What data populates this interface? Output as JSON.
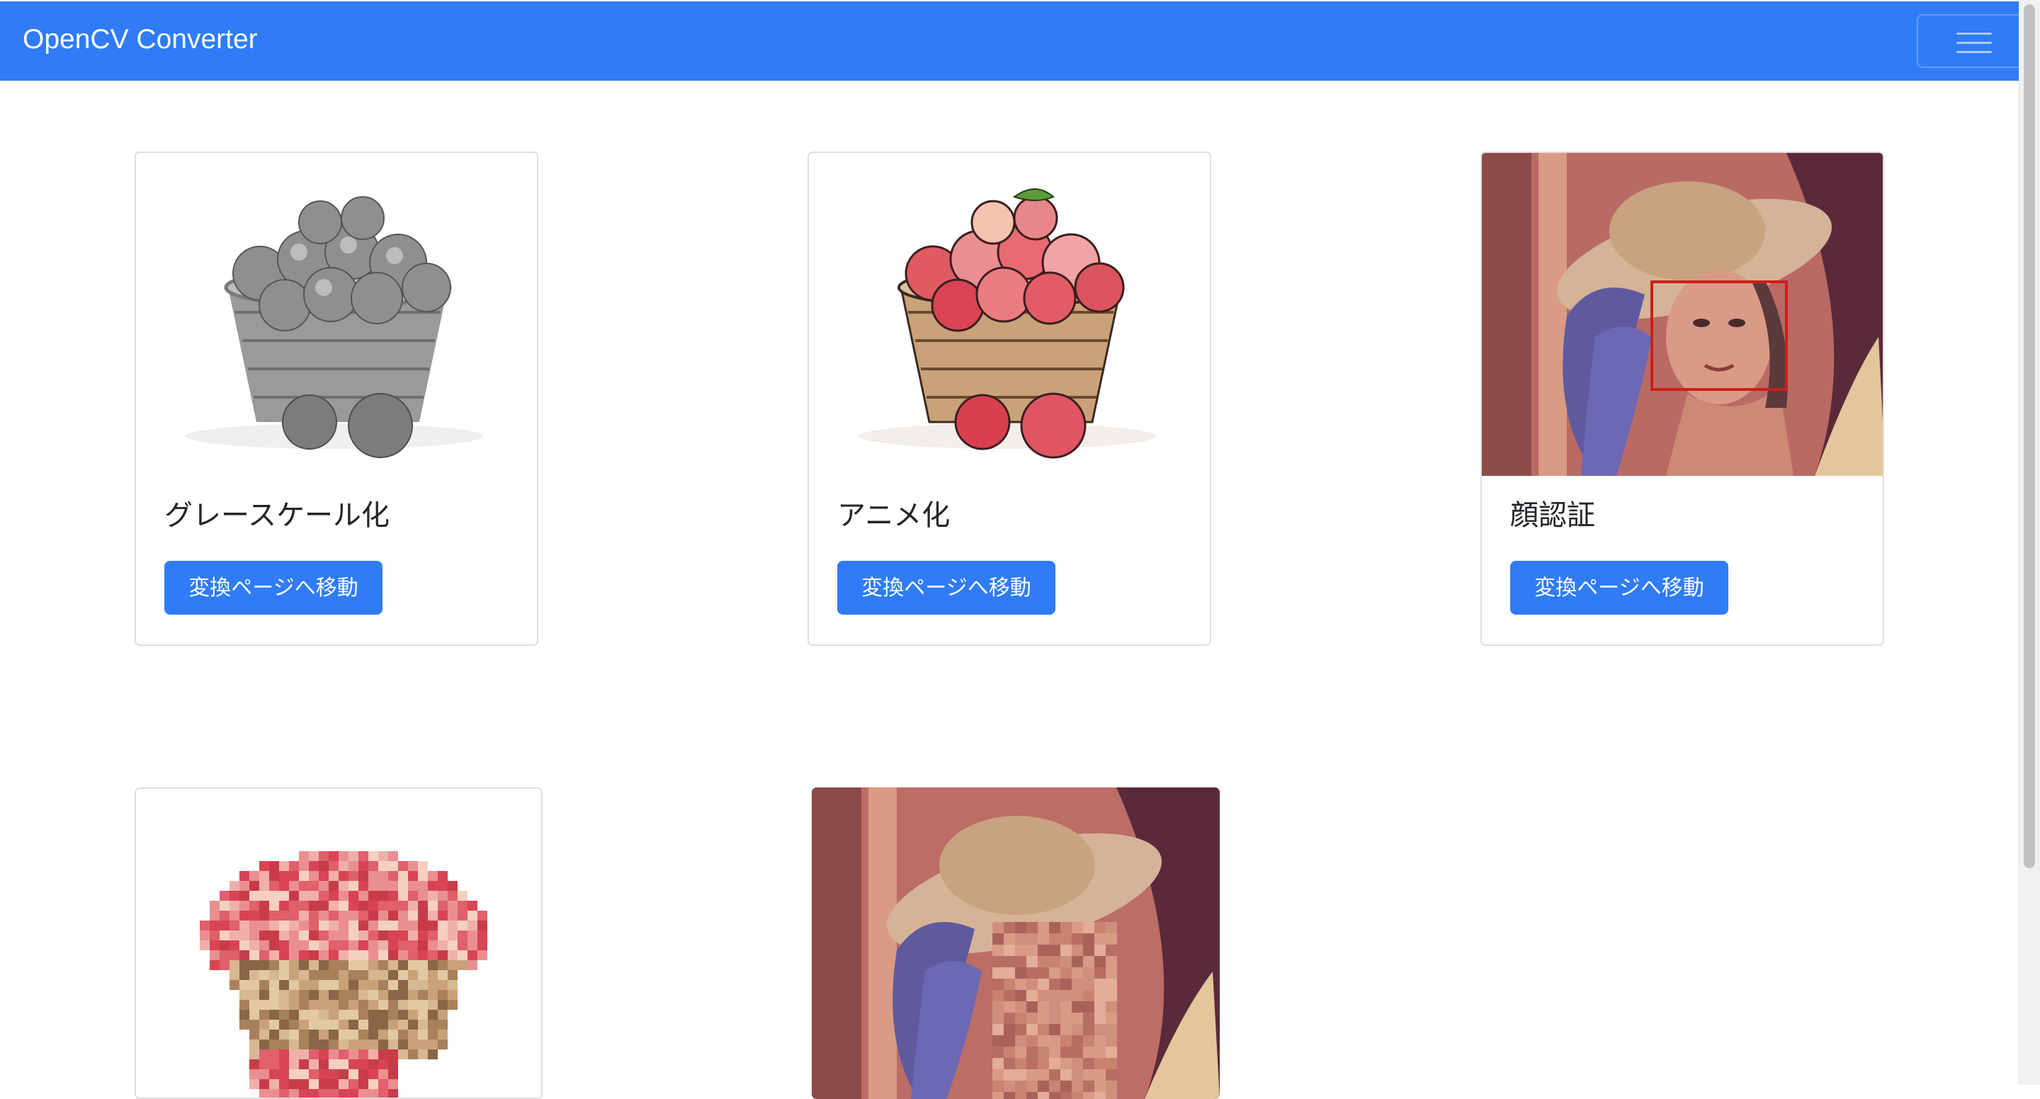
{
  "navbar": {
    "brand": "OpenCV Converter",
    "toggle_icon": "hamburger-menu-icon"
  },
  "cards": [
    {
      "title": "グレースケール化",
      "button_label": "変換ページへ移動",
      "image": "grayscale-apple-basket"
    },
    {
      "title": "アニメ化",
      "button_label": "変換ページへ移動",
      "image": "anime-apple-basket"
    },
    {
      "title": "顔認証",
      "button_label": "変換ページへ移動",
      "image": "face-detection-portrait"
    },
    {
      "image": "mosaic-apple-basket"
    },
    {
      "image": "mosaic-face-portrait"
    }
  ],
  "colors": {
    "primary": "#2f7cf6",
    "face_box": "#cc1f1a"
  }
}
